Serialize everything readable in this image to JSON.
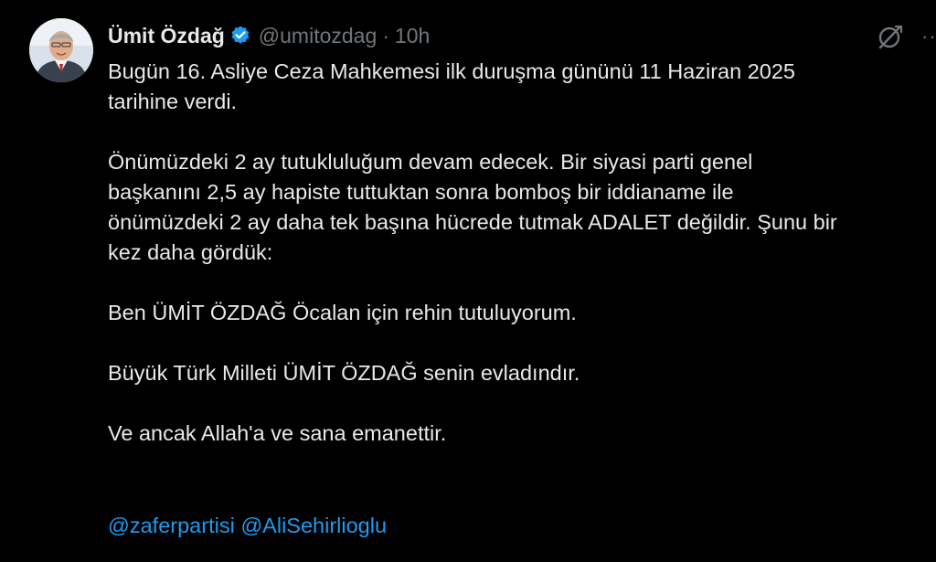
{
  "author": {
    "display_name": "Ümit Özdağ",
    "handle": "@umitozdag",
    "separator": "·",
    "time": "10h",
    "verified": true
  },
  "tweet": {
    "paragraphs": [
      [
        "Bugün 16. Asliye Ceza Mahkemesi ilk duruşma gününü 11 Haziran 2025",
        "tarihine verdi."
      ],
      [
        "Önümüzdeki 2 ay tutukluluğum devam edecek. Bir siyasi parti genel",
        "başkanını 2,5 ay hapiste tuttuktan sonra bomboş bir iddianame ile",
        "önümüzdeki 2 ay daha tek başına hücrede tutmak ADALET değildir. Şunu bir",
        "kez daha gördük:"
      ],
      [
        "Ben ÜMİT ÖZDAĞ Öcalan için rehin tutuluyorum."
      ],
      [
        "Büyük Türk Milleti ÜMİT ÖZDAĞ senin evladındır."
      ],
      [
        "Ve ancak Allah'a ve sana emanettir."
      ]
    ],
    "mentions": [
      "@zaferpartisi",
      "@AliSehirlioglu"
    ]
  },
  "icons": {
    "verified": "verified-badge-icon",
    "grok": "grok-icon",
    "more": "more-options-icon"
  },
  "colors": {
    "background": "#000000",
    "text": "#e7e9ea",
    "muted": "#71767b",
    "accent": "#1d9bf0"
  }
}
